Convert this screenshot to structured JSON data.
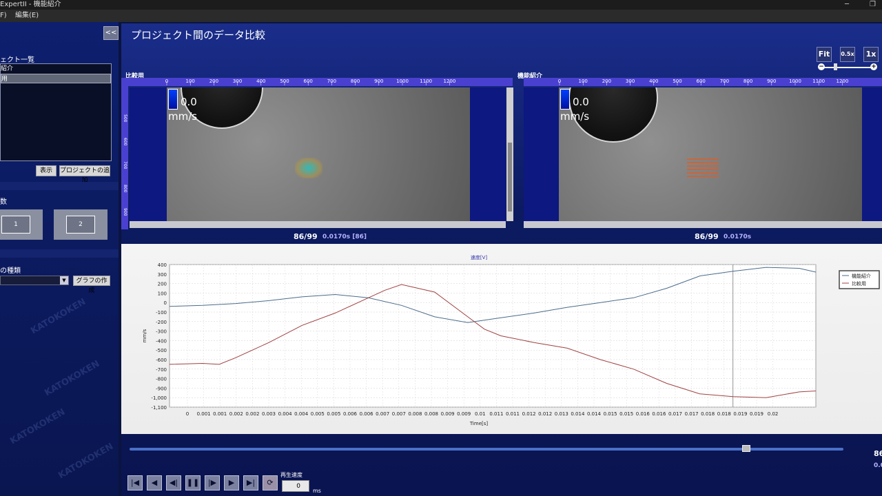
{
  "window": {
    "title": "ExpertII - 機能紹介"
  },
  "menu": {
    "file": "F)",
    "edit": "編集(E)"
  },
  "left_panel": {
    "collapse_label": "<<",
    "project_list_label": "ェクト一覧",
    "projects": [
      "紹介",
      "用"
    ],
    "show_button": "表示",
    "add_project_button": "プロジェクトの追加",
    "count_label": "数",
    "layout_options": [
      "1",
      "2"
    ],
    "graph_type_label": "の種類",
    "create_graph_button": "グラフの作成"
  },
  "main": {
    "title": "プロジェクト間のデータ比較",
    "zoom": {
      "fit": "Fit",
      "half": "0.5x",
      "one": "1x"
    },
    "viewports": [
      {
        "label": "比較用",
        "scale_value": "0.0",
        "scale_unit": "mm/s",
        "frame": "86/99",
        "time": "0.0170s [86]"
      },
      {
        "label": "機能紹介",
        "scale_value": "0.0",
        "scale_unit": "mm/s",
        "frame": "86/99",
        "time": "0.0170s"
      }
    ],
    "ruler_h_ticks": [
      "0",
      "100",
      "200",
      "300",
      "400",
      "500",
      "600",
      "700",
      "800",
      "900",
      "1000",
      "1100",
      "1200"
    ],
    "ruler_v_ticks": [
      "500",
      "600",
      "700",
      "800",
      "900"
    ],
    "watermark": "KATOKOKEN"
  },
  "chart_data": {
    "type": "line",
    "title": "速度[V]",
    "xlabel": "Time[s]",
    "ylabel": "mm/s",
    "ylim": [
      -1100,
      400
    ],
    "yticks": [
      400,
      300,
      200,
      100,
      0,
      -100,
      -200,
      -300,
      -400,
      -500,
      -600,
      -700,
      -800,
      -900,
      -1000,
      -1100
    ],
    "ytick_labels": [
      "400",
      "300",
      "200",
      "100",
      "0",
      "-100",
      "-200",
      "-300",
      "-400",
      "-500",
      "-600",
      "-700",
      "-800",
      "-900",
      "-1,000",
      "-1,100"
    ],
    "xlim": [
      0,
      0.0195
    ],
    "xtick_labels": [
      "0",
      "0.001",
      "0.001",
      "0.002",
      "0.002",
      "0.003",
      "0.004",
      "0.004",
      "0.005",
      "0.005",
      "0.006",
      "0.006",
      "0.007",
      "0.007",
      "0.008",
      "0.008",
      "0.009",
      "0.009",
      "0.01",
      "0.011",
      "0.011",
      "0.012",
      "0.012",
      "0.013",
      "0.014",
      "0.014",
      "0.015",
      "0.015",
      "0.016",
      "0.016",
      "0.017",
      "0.017",
      "0.018",
      "0.018",
      "0.019",
      "0.019",
      "0.02"
    ],
    "cursor_x": 0.017,
    "grid": true,
    "legend_position": "top-right",
    "series": [
      {
        "name": "機能紹介",
        "color": "#4a6a8a",
        "x": [
          0,
          0.001,
          0.002,
          0.003,
          0.004,
          0.005,
          0.006,
          0.007,
          0.008,
          0.009,
          0.01,
          0.011,
          0.012,
          0.013,
          0.014,
          0.015,
          0.016,
          0.017,
          0.018,
          0.019,
          0.0195
        ],
        "y": [
          -40,
          -30,
          -10,
          20,
          60,
          85,
          50,
          -30,
          -150,
          -210,
          -160,
          -110,
          -50,
          0,
          50,
          150,
          280,
          330,
          370,
          360,
          320
        ]
      },
      {
        "name": "比較用",
        "color": "#a04040",
        "x": [
          0,
          0.001,
          0.0015,
          0.002,
          0.003,
          0.004,
          0.005,
          0.006,
          0.0065,
          0.007,
          0.008,
          0.009,
          0.0095,
          0.01,
          0.011,
          0.012,
          0.013,
          0.014,
          0.015,
          0.016,
          0.017,
          0.018,
          0.019,
          0.0195
        ],
        "y": [
          -650,
          -640,
          -650,
          -580,
          -420,
          -240,
          -110,
          50,
          130,
          190,
          110,
          -150,
          -280,
          -350,
          -420,
          -480,
          -600,
          -700,
          -850,
          -960,
          -990,
          -1000,
          -940,
          -930
        ]
      }
    ]
  },
  "playback": {
    "speed_label": "再生速度",
    "speed_value": "0",
    "speed_unit": "ms",
    "progress": 0.868,
    "frame": "86",
    "time": "0.0"
  }
}
